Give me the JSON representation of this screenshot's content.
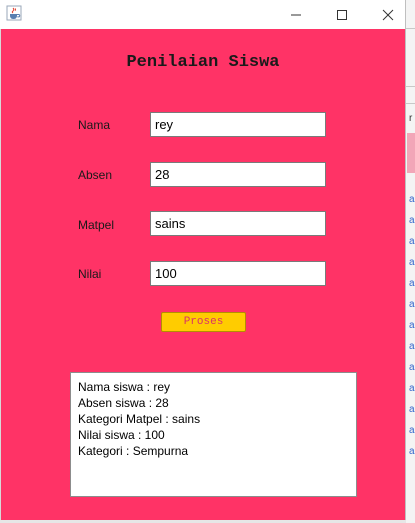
{
  "window": {
    "icon": "java-cup-icon",
    "controls": [
      "minimize-icon",
      "maximize-icon",
      "close-icon"
    ]
  },
  "form": {
    "title": "Penilaian Siswa",
    "fields": [
      {
        "label": "Nama",
        "value": "rey"
      },
      {
        "label": "Absen",
        "value": "28"
      },
      {
        "label": "Matpel",
        "value": "sains"
      },
      {
        "label": "Nilai",
        "value": "100"
      }
    ],
    "button_label": "Proses"
  },
  "output": {
    "lines": [
      "Nama siswa : rey",
      "Absen siswa : 28",
      "Kategori Matpel : sains",
      "Nilai siswa : 100",
      "Kategori : Sempurna"
    ]
  },
  "background_window": {
    "glyphs": [
      "r",
      "a",
      "a",
      "a",
      "a",
      "a",
      "a",
      "a",
      "a",
      "a",
      "a",
      "a",
      "a",
      "a"
    ]
  },
  "colors": {
    "panel_bg": "#ff3366",
    "button_bg": "#ffcc00",
    "button_text": "#d93366"
  }
}
